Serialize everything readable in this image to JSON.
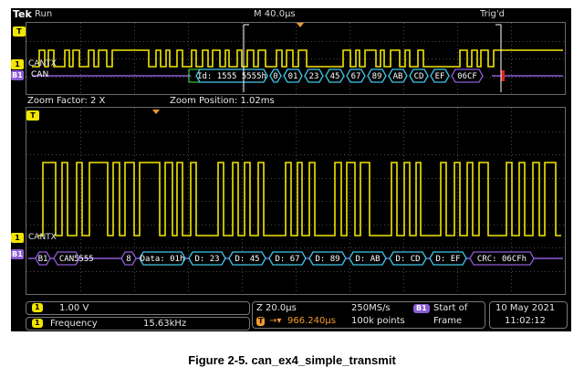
{
  "header": {
    "brand": "Tek",
    "run_state": "Run",
    "horizontal_scale": "M 40.0µs",
    "trigger_status": "Trig'd"
  },
  "top_pane": {
    "trigger_marker": "T",
    "channel_marker": "1",
    "channel_label": "CANTX",
    "bus_marker": "B1",
    "bus_label": "CAN",
    "bus_packets": [
      "Id: 1555 5555h",
      "0",
      "01",
      "23",
      "45",
      "67",
      "89",
      "AB",
      "CD",
      "EF",
      "06CF"
    ]
  },
  "zoom_pane": {
    "zoom_factor": "Zoom Factor: 2 X",
    "zoom_position": "Zoom Position: 1.02ms",
    "trigger_marker": "T",
    "channel_marker": "1",
    "channel_label": "CANTX",
    "bus_marker": "B1",
    "bus_label": "CAN",
    "bus_id": "5555",
    "bus_packets": [
      "8",
      "Data: 01h",
      "D: 23",
      "D: 45",
      "D: 67",
      "D: 89",
      "D: AB",
      "D: CD",
      "D: EF",
      "CRC: 06CFh"
    ]
  },
  "status": {
    "ch1_marker": "1",
    "ch1_scale": "1.00 V",
    "time_scale": "Z 20.0µs",
    "trigger_position": "966.240µs",
    "trigger_pos_marker": "T",
    "sample_rate": "250MS/s",
    "record_length": "100k points",
    "trigger_source": "B1",
    "trigger_type_line1": "Start of",
    "trigger_type_line2": "Frame",
    "date": "10 May 2021",
    "time": "11:02:12",
    "measure_marker": "1",
    "measure_name": "Frequency",
    "measure_value": "15.63kHz"
  },
  "caption": "Figure 2-5. can_ex4_simple_transmit",
  "colors": {
    "channel1": "#f2e600",
    "bus": "#8c5bd6",
    "packet": "#3fc7ea",
    "trigger": "#f29a2e",
    "grid": "#4a4a4a"
  }
}
